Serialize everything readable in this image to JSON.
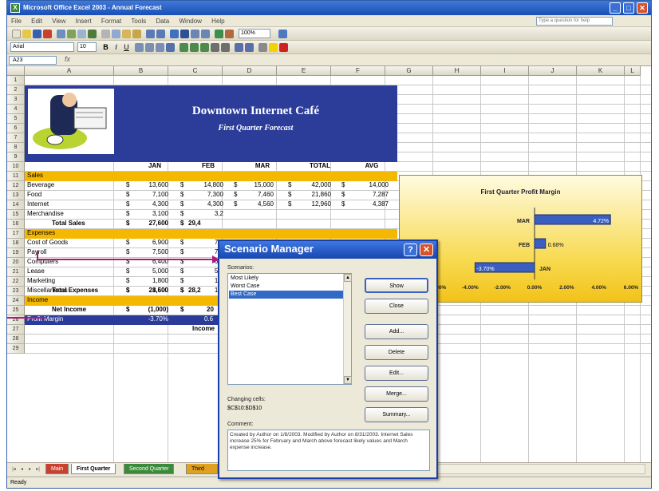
{
  "window": {
    "title": "Microsoft Office Excel 2003 - Annual Forecast",
    "min": "_",
    "max": "□",
    "close": "✕"
  },
  "menu": [
    "File",
    "Edit",
    "View",
    "Insert",
    "Format",
    "Tools",
    "Data",
    "Window",
    "Help"
  ],
  "help_placeholder": "Type a question for help",
  "toolbar": {
    "zoom": "100%",
    "font": "Arial",
    "size": "10"
  },
  "name_box": "A23",
  "fx": "fx",
  "columns": [
    "A",
    "B",
    "C",
    "D",
    "E",
    "F",
    "G",
    "H",
    "I",
    "J",
    "K",
    "L"
  ],
  "rows": [
    "1",
    "2",
    "3",
    "4",
    "5",
    "6",
    "7",
    "8",
    "9",
    "10",
    "11",
    "12",
    "13",
    "14",
    "15",
    "16",
    "17",
    "18",
    "19",
    "20",
    "21",
    "22",
    "23",
    "24",
    "25",
    "26",
    "27",
    "28",
    "29"
  ],
  "banner": {
    "title": "Downtown Internet Café",
    "subtitle": "First Quarter Forecast"
  },
  "headers": {
    "jan": "JAN",
    "feb": "FEB",
    "mar": "MAR",
    "total": "TOTAL",
    "avg": "AVG"
  },
  "sales": {
    "section": "Sales",
    "rows": [
      {
        "label": "Beverage",
        "jan": "13,600",
        "feb": "14,800",
        "mar": "15,000",
        "total": "42,000",
        "avg": "14,000"
      },
      {
        "label": "Food",
        "jan": "7,100",
        "feb": "7,300",
        "mar": "7,460",
        "total": "21,860",
        "avg": "7,287"
      },
      {
        "label": "Internet",
        "jan": "4,300",
        "feb": "4,300",
        "mar": "4,560",
        "total": "12,960",
        "avg": "4,387"
      },
      {
        "label": "Merchandise",
        "jan": "3,100",
        "feb": "3,2"
      }
    ],
    "total": {
      "label": "Total Sales",
      "jan": "27,600",
      "feb": "29,4"
    }
  },
  "expenses": {
    "section": "Expenses",
    "rows": [
      {
        "label": "Cost of Goods",
        "jan": "6,900",
        "feb": "7,3"
      },
      {
        "label": "Payroll",
        "jan": "7,500",
        "feb": "7,5"
      },
      {
        "label": "Computers",
        "jan": "6,400",
        "feb": "6,4"
      },
      {
        "label": "Lease",
        "jan": "5,000",
        "feb": "5,0"
      },
      {
        "label": "Marketing",
        "jan": "1,800",
        "feb": "1,3"
      },
      {
        "label": "Miscellaneous",
        "jan": "1,500",
        "feb": "1,5"
      }
    ],
    "total": {
      "label": "Total Expenses",
      "jan": "28,600",
      "feb": "28,2"
    }
  },
  "income": {
    "section": "Income",
    "net_label": "Net Income",
    "net_jan": "(1,000)",
    "net_feb": "20",
    "margin_label": "Profit Margin",
    "margin_jan": "-3.70%",
    "margin_feb": "0.6",
    "income_label": "Income"
  },
  "currency": "$",
  "chart_data": {
    "type": "bar",
    "orientation": "horizontal",
    "title": "First Quarter Profit Margin",
    "categories": [
      "MAR",
      "FEB",
      "JAN"
    ],
    "values": [
      4.72,
      0.68,
      -3.7
    ],
    "data_labels": [
      "4.72%",
      "0.68%",
      "-3.70%"
    ],
    "xlim": [
      -6,
      6
    ],
    "x_ticks": [
      "-6.00%",
      "-4.00%",
      "-2.00%",
      "0.00%",
      "2.00%",
      "4.00%",
      "6.00%"
    ],
    "grid": false
  },
  "dialog": {
    "title": "Scenario Manager",
    "help": "?",
    "close": "✕",
    "scenarios_label": "Scenarios:",
    "scenarios": [
      "Most Likely",
      "Worst Case",
      "Best Case"
    ],
    "selected_index": 2,
    "changing_label": "Changing cells:",
    "changing_value": "$C$10:$D$10",
    "comment_label": "Comment:",
    "comment": "Created by Author on 1/8/2003. Modified by Author on 8/31/2003. Internet Sales increase 25% for February and March above forecast likely values and March expense increase.",
    "buttons": [
      "Show",
      "Close",
      "Add...",
      "Delete",
      "Edit...",
      "Merge...",
      "Summary..."
    ]
  },
  "tabs": [
    "Main",
    "First Quarter",
    "Second Quarter",
    "Third"
  ],
  "status": "Ready"
}
